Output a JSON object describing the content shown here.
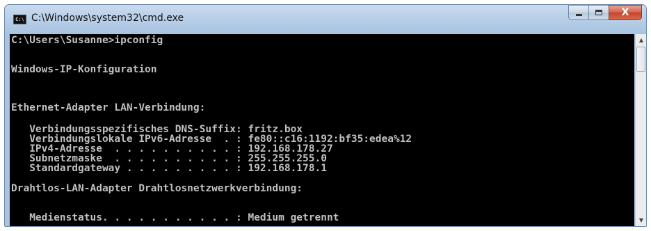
{
  "window": {
    "title": "C:\\Windows\\system32\\cmd.exe",
    "icon_name": "cmd-icon",
    "icon_text": "C:\\",
    "buttons": {
      "minimize": "minimize-icon",
      "maximize": "maximize-icon",
      "close": "close-icon",
      "close_glyph": "X"
    }
  },
  "console": {
    "background": "#000000",
    "foreground": "#c0c0c0",
    "lines": [
      "C:\\Users\\Susanne>ipconfig",
      "Windows-IP-Konfiguration",
      "Ethernet-Adapter LAN-Verbindung:",
      "   Verbindungsspezifisches DNS-Suffix: fritz.box",
      "   Verbindungslokale IPv6-Adresse  . : fe80::c16:1192:bf35:edea%12",
      "   IPv4-Adresse  . . . . . . . . . . : 192.168.178.27",
      "   Subnetzmaske  . . . . . . . . . . : 255.255.255.0",
      "   Standardgateway . . . . . . . . . : 192.168.178.1",
      "Drahtlos-LAN-Adapter Drahtlosnetzwerkverbindung:",
      "   Medienstatus. . . . . . . . . . . : Medium getrennt"
    ]
  },
  "scrollbar": {
    "up_icon": "scroll-up-icon",
    "down_icon": "scroll-down-icon"
  }
}
